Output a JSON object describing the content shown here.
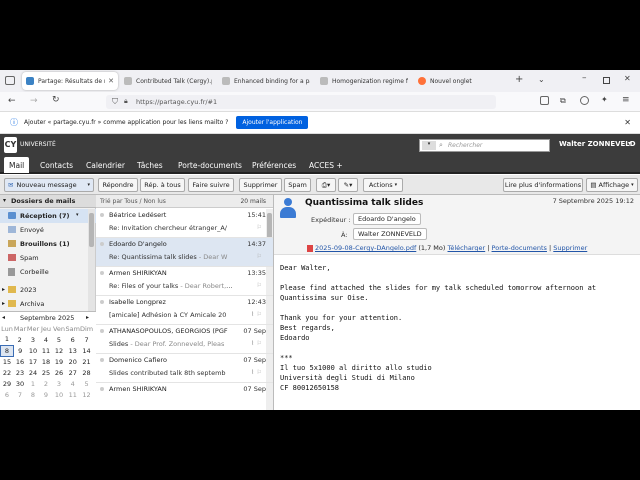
{
  "browser": {
    "tabs": [
      {
        "label": "Partage: Résultats de rech",
        "active": true
      },
      {
        "label": "Contributed Talk (Cergy).pdf"
      },
      {
        "label": "Enhanced binding for a partic"
      },
      {
        "label": "Homogenization regime for s"
      },
      {
        "label": "Nouvel onglet"
      }
    ],
    "url": "https://partage.cyu.fr/#1",
    "notification": {
      "text": "Ajouter « partage.cyu.fr » comme application pour les liens mailto ?",
      "button": "Ajouter l'application"
    }
  },
  "app": {
    "logo_text": "UNIVERSITÉ",
    "search_placeholder": "Rechercher",
    "user": "Walter ZONNEVELD",
    "menu": [
      "Mail",
      "Contacts",
      "Calendrier",
      "Tâches",
      "Porte-documents",
      "Préférences",
      "ACCES +"
    ],
    "toolbar": {
      "new": "Nouveau message",
      "reply": "Répondre",
      "reply_all": "Rép. à tous",
      "forward": "Faire suivre",
      "delete": "Supprimer",
      "spam": "Spam",
      "actions": "Actions",
      "read_more": "Lire plus d'informations",
      "display": "Affichage"
    }
  },
  "folders": {
    "header": "Dossiers de mails",
    "items": [
      {
        "label": "Réception (7)",
        "bold": true
      },
      {
        "label": "Envoyé"
      },
      {
        "label": "Brouillons (1)",
        "bold": true
      },
      {
        "label": "Spam"
      },
      {
        "label": "Corbeille"
      },
      {
        "label": "2023"
      },
      {
        "label": "Archiva"
      }
    ]
  },
  "calendar": {
    "month": "Septembre 2025",
    "weekdays": [
      "Lun",
      "Mar",
      "Mer",
      "Jeu",
      "Ven",
      "Sam",
      "Dim"
    ],
    "weeks": [
      [
        "1",
        "2",
        "3",
        "4",
        "5",
        "6",
        "7"
      ],
      [
        "8",
        "9",
        "10",
        "11",
        "12",
        "13",
        "14"
      ],
      [
        "15",
        "16",
        "17",
        "18",
        "19",
        "20",
        "21"
      ],
      [
        "22",
        "23",
        "24",
        "25",
        "26",
        "27",
        "28"
      ],
      [
        "29",
        "30",
        "1",
        "2",
        "3",
        "4",
        "5"
      ],
      [
        "6",
        "7",
        "8",
        "9",
        "10",
        "11",
        "12"
      ]
    ]
  },
  "list": {
    "sort": "Trié par Tous / Non lus",
    "count": "20 mails",
    "messages": [
      {
        "from": "Béatrice Ledésert",
        "date": "15:41",
        "subject": "Re: Invitation chercheur étranger_A/",
        "preview": ""
      },
      {
        "from": "Edoardo D'angelo",
        "date": "14:37",
        "subject": "Re: Quantissima talk slides",
        "preview": " - Dear W"
      },
      {
        "from": "Armen SHIRIKYAN",
        "date": "13:35",
        "subject": "Re: Files of your talks",
        "preview": " - Dear Robert, No"
      },
      {
        "from": "Isabelle Longprez",
        "date": "12:43",
        "subject": "[amicale] Adhésion à CY Amicale 20",
        "preview": ""
      },
      {
        "from": "ATHANASOPOULOS, GEORGIOS (PGF",
        "date": "07 Sep",
        "subject": "Slides",
        "preview": " - Dear Prof. Zonneveld, Pleas"
      },
      {
        "from": "Domenico Cafiero",
        "date": "07 Sep",
        "subject": "Slides contributed talk 8th septemb",
        "preview": ""
      },
      {
        "from": "Armen SHIRIKYAN",
        "date": "07 Sep",
        "subject": "",
        "preview": ""
      }
    ]
  },
  "preview": {
    "subject": "Quantissima talk slides",
    "date": "7 Septembre 2025 19:12",
    "sender_label": "Expéditeur :",
    "sender": "Edoardo D'angelo",
    "to_label": "À:",
    "to": "Walter ZONNEVELD",
    "attachment": {
      "name": "2025-09-08-Cergy-DAngelo.pdf",
      "size": "(1,7 Mo)",
      "download": "Télécharger",
      "docs": "Porte-documents",
      "delete": "Supprimer"
    },
    "body": "Dear Walter,\n\nPlease find attached the slides for my talk scheduled tomorrow afternoon at\nQuantissima sur Oise.\n\nThank you for your attention.\nBest regards,\nEdoardo\n\n***\nIl tuo 5x1000 al diritto allo studio\nUniversità degli Studi di Milano\nCF 80012650158"
  }
}
